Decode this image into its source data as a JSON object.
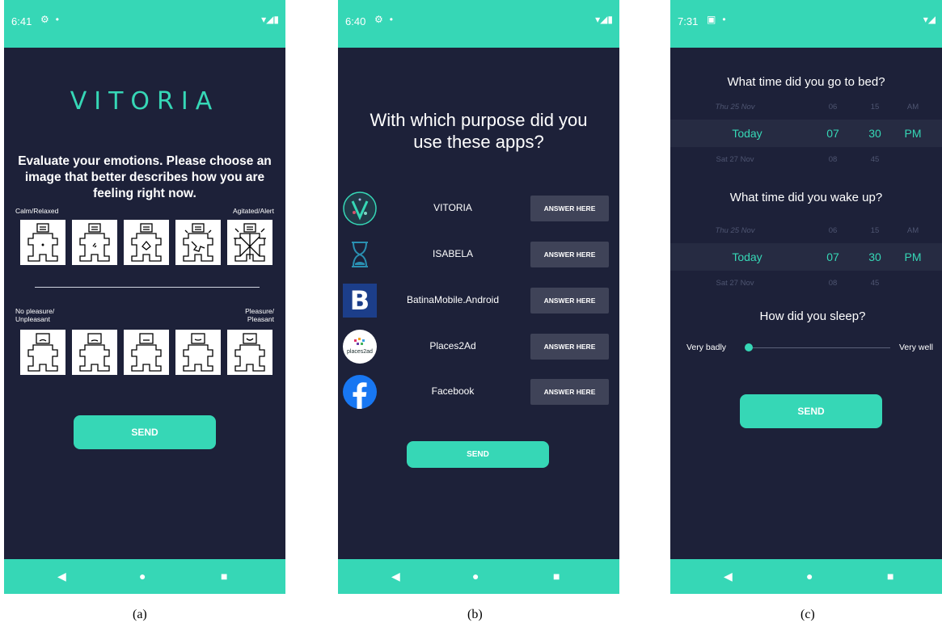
{
  "phone_a": {
    "status": {
      "time": "6:41"
    },
    "title": "VITORIA",
    "instruction": "Evaluate your emotions. Please choose an image that better describes how you are feeling right now.",
    "arousal": {
      "low_label": "Calm/Relaxed",
      "high_label": "Agitated/Alert"
    },
    "valence": {
      "low_label": "No pleasure/\nUnpleasant",
      "high_label": "Pleasure/\nPleasant"
    },
    "send_label": "SEND",
    "caption": "(a)"
  },
  "phone_b": {
    "status": {
      "time": "6:40"
    },
    "title": "With which purpose did you use these apps?",
    "apps": [
      {
        "name": "VITORIA",
        "button": "ANSWER HERE",
        "icon": "vitoria-app-icon"
      },
      {
        "name": "ISABELA",
        "button": "ANSWER HERE",
        "icon": "hourglass-app-icon"
      },
      {
        "name": "BatinaMobile.Android",
        "button": "ANSWER HERE",
        "icon": "letter-b-app-icon"
      },
      {
        "name": "Places2Ad",
        "button": "ANSWER HERE",
        "icon": "places2ad-app-icon"
      },
      {
        "name": "Facebook",
        "button": "ANSWER HERE",
        "icon": "facebook-app-icon"
      }
    ],
    "icon_b_letter": "B",
    "icon_p2a_text": "places2ad",
    "send_label": "SEND",
    "caption": "(b)"
  },
  "phone_c": {
    "status": {
      "time": "7:31"
    },
    "bed_question": "What time did you go to bed?",
    "wake_question": "What time did you wake up?",
    "picker": {
      "prev": {
        "day": "Thu 25 Nov",
        "hour": "06",
        "minute": "15",
        "ampm": "AM"
      },
      "sel": {
        "day": "Today",
        "hour": "07",
        "minute": "30",
        "ampm": "PM"
      },
      "next": {
        "day": "Sat 27 Nov",
        "hour": "08",
        "minute": "45",
        "ampm": ""
      }
    },
    "sleep_question": "How did you sleep?",
    "slider": {
      "min_label": "Very badly",
      "max_label": "Very well",
      "value": 0
    },
    "send_label": "SEND",
    "caption": "(c)"
  },
  "colors": {
    "accent": "#36d7b6",
    "background": "#1d2139",
    "button_dark": "#3f4358"
  }
}
